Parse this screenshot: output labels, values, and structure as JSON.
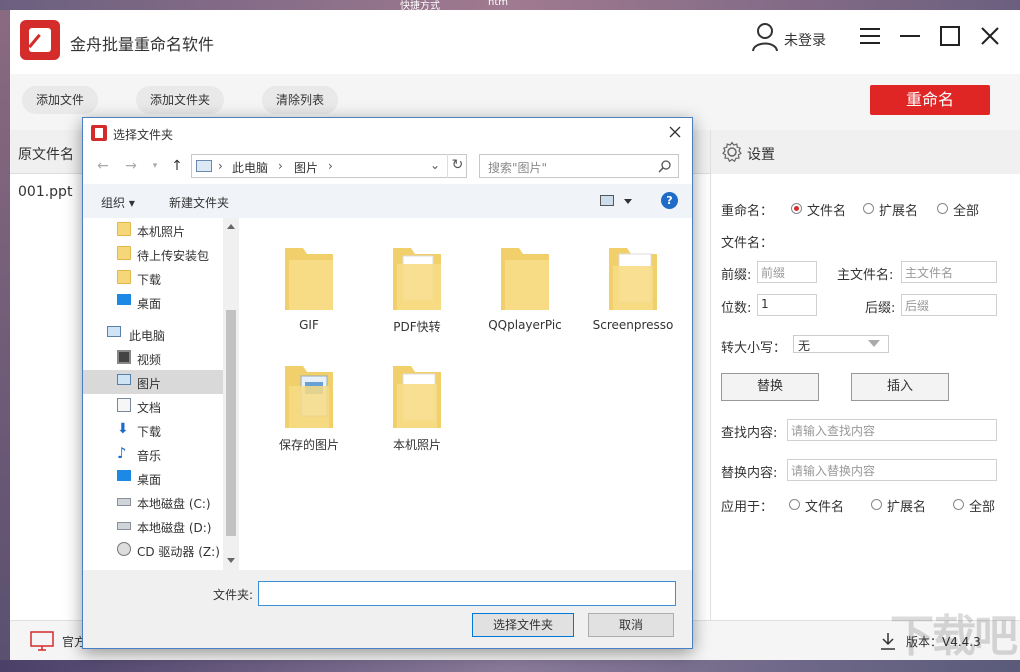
{
  "desktop": {
    "shortcut_text": "快捷方式",
    "htm_text": "htm"
  },
  "app": {
    "title": "金舟批量重命名软件",
    "user_label": "未登录",
    "toolbar": {
      "add_file": "添加文件",
      "add_folder": "添加文件夹",
      "clear_list": "清除列表",
      "rename": "重命名"
    },
    "list": {
      "header": "原文件名",
      "rows": [
        "001.ppt"
      ]
    },
    "settings": {
      "title": "设置",
      "rename_label": "重命名：",
      "rename_options": [
        "文件名",
        "扩展名",
        "全部"
      ],
      "filename_label": "文件名：",
      "prefix_label": "前缀:",
      "prefix_placeholder": "前缀",
      "main_label": "主文件名:",
      "main_placeholder": "主文件名",
      "digits_label": "位数:",
      "digits_value": "1",
      "suffix_label": "后缀:",
      "suffix_placeholder": "后缀",
      "case_label": "转大小写：",
      "case_value": "无",
      "replace_btn": "替换",
      "insert_btn": "插入",
      "find_label": "查找内容:",
      "find_placeholder": "请输入查找内容",
      "replace_label": "替换内容:",
      "replace_placeholder": "请输入替换内容",
      "apply_label": "应用于：",
      "apply_options": [
        "文件名",
        "扩展名",
        "全部"
      ]
    },
    "footer": {
      "site_text": "官方",
      "version": "版本：V4.4.3"
    },
    "watermark": "下载吧"
  },
  "dialog": {
    "title": "选择文件夹",
    "breadcrumb": [
      "此电脑",
      "图片"
    ],
    "search_placeholder": "搜索\"图片\"",
    "organize": "组织",
    "new_folder": "新建文件夹",
    "help": "?",
    "nav_items": [
      {
        "label": "本机照片",
        "icon": "folder-icon"
      },
      {
        "label": "待上传安装包",
        "icon": "folder-icon"
      },
      {
        "label": "下载",
        "icon": "folder-icon"
      },
      {
        "label": "桌面",
        "icon": "desktop-icon"
      },
      {
        "label": "此电脑",
        "icon": "computer-icon"
      },
      {
        "label": "视频",
        "icon": "video-icon"
      },
      {
        "label": "图片",
        "icon": "pictures-icon"
      },
      {
        "label": "文档",
        "icon": "documents-icon"
      },
      {
        "label": "下载",
        "icon": "download-icon"
      },
      {
        "label": "音乐",
        "icon": "music-icon"
      },
      {
        "label": "桌面",
        "icon": "desktop-icon"
      },
      {
        "label": "本地磁盘 (C:)",
        "icon": "drive-icon"
      },
      {
        "label": "本地磁盘 (D:)",
        "icon": "drive-icon"
      },
      {
        "label": "CD 驱动器 (Z:)",
        "icon": "cd-drive-icon"
      }
    ],
    "folders": [
      "GIF",
      "PDF快转",
      "QQplayerPic",
      "Screenpresso",
      "保存的图片",
      "本机照片"
    ],
    "folder_label": "文件夹:",
    "folder_value": "",
    "select_btn": "选择文件夹",
    "cancel_btn": "取消",
    "colors": {
      "accent": "#d42b2b",
      "dialog_border": "#4a7fc8",
      "selected": "#d9d9d9"
    }
  }
}
